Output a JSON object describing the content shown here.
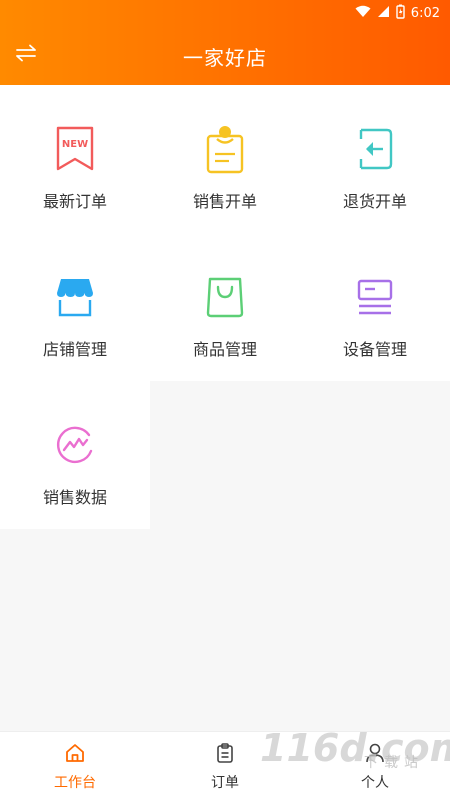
{
  "status_bar": {
    "time": "6:02",
    "icons": [
      "wifi-icon",
      "signal-icon",
      "battery-icon"
    ]
  },
  "header": {
    "title": "一家好店",
    "switch_icon": "switch-arrows-icon"
  },
  "grid": {
    "items": [
      {
        "label": "最新订单",
        "icon": "new-order-icon",
        "color": "#f25b5b",
        "badge": "NEW"
      },
      {
        "label": "销售开单",
        "icon": "sales-order-icon",
        "color": "#f6c323"
      },
      {
        "label": "退货开单",
        "icon": "return-order-icon",
        "color": "#41c7c4"
      },
      {
        "label": "店铺管理",
        "icon": "store-icon",
        "color": "#2aa9f0"
      },
      {
        "label": "商品管理",
        "icon": "shopping-bag-icon",
        "color": "#5ccf76"
      },
      {
        "label": "设备管理",
        "icon": "device-card-icon",
        "color": "#a770e8"
      },
      {
        "label": "销售数据",
        "icon": "sales-chart-icon",
        "color": "#ea6fd0"
      }
    ]
  },
  "tabbar": {
    "tabs": [
      {
        "label": "工作台",
        "icon": "home-icon",
        "active": true
      },
      {
        "label": "订单",
        "icon": "clipboard-icon",
        "active": false
      },
      {
        "label": "个人",
        "icon": "person-icon",
        "active": false
      }
    ],
    "accent": "#ff6a00"
  },
  "watermark": {
    "brand": "116d.com",
    "text": "下载站"
  }
}
